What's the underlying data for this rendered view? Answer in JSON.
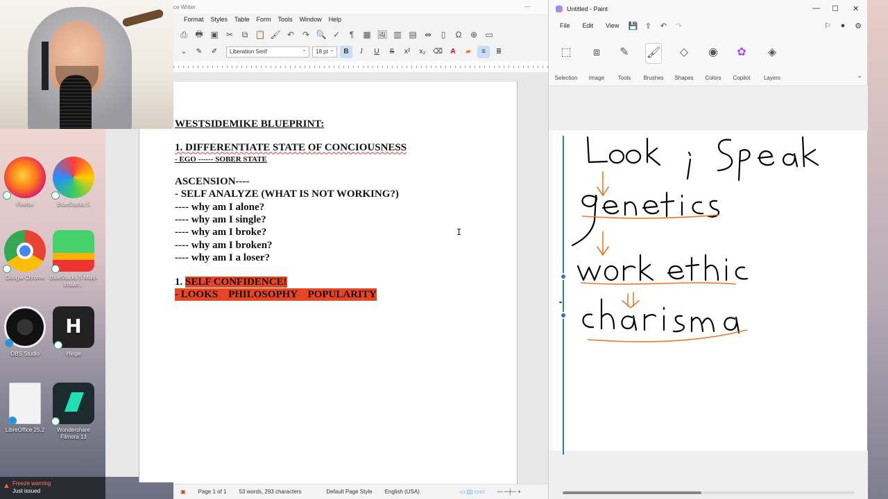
{
  "desktop": {
    "icons": [
      {
        "label": "Firefox"
      },
      {
        "label": "BlueStacks 5"
      },
      {
        "label": "Google Chrome"
      },
      {
        "label": "BlueStacks 5 Multi-Instan..."
      },
      {
        "label": "OBS Studio"
      },
      {
        "label": "Hinge"
      },
      {
        "label": "LibreOffice 25.2"
      },
      {
        "label": "Wondershare Filmora 13"
      }
    ],
    "toast": {
      "title": "Freeze warning",
      "subtitle": "Just issued"
    }
  },
  "writer": {
    "title": "ce Writer",
    "menu": [
      "Format",
      "Styles",
      "Table",
      "Form",
      "Tools",
      "Window",
      "Help"
    ],
    "font_name": "Liberation Serif",
    "font_size": "18 pt",
    "document": {
      "heading": "WESTSIDEMIKE BLUEPRINT:",
      "item1": "1. DIFFERENTIATE STATE OF CONCIOUSNESS",
      "item1_sub": "- EGO ------ SOBER STATE",
      "ascension": "ASCENSION----",
      "self_analyze": "- SELF ANALYZE (WHAT IS NOT WORKING?)",
      "questions": [
        "---- why am I alone?",
        "---- why am I single?",
        "---- why am I broke?",
        "---- why am I broken?",
        "---- why am I a loser?"
      ],
      "item2_prefix": "1. ",
      "item2_highlight": "SELF CONFIDENCE!",
      "item2_sub": "- LOOKS    PHILOSOPHY    POPULARITY"
    },
    "status": {
      "page": "Page 1 of 1",
      "words": "53 words, 293 characters",
      "style": "Default Page Style",
      "language": "English (USA)"
    }
  },
  "paint": {
    "title": "Untitled - Paint",
    "menu": [
      "File",
      "Edit",
      "View"
    ],
    "ribbon": [
      "Selection",
      "Image",
      "Tools",
      "Brushes",
      "Shapes",
      "Colors",
      "Copilot",
      "Layers"
    ],
    "handwriting": [
      "Look ; Speak",
      "genetics",
      "work ethic",
      "charisma"
    ],
    "ink_color": "#000000",
    "accent_color": "#e8792a",
    "slider_color": "#2a78c2"
  }
}
